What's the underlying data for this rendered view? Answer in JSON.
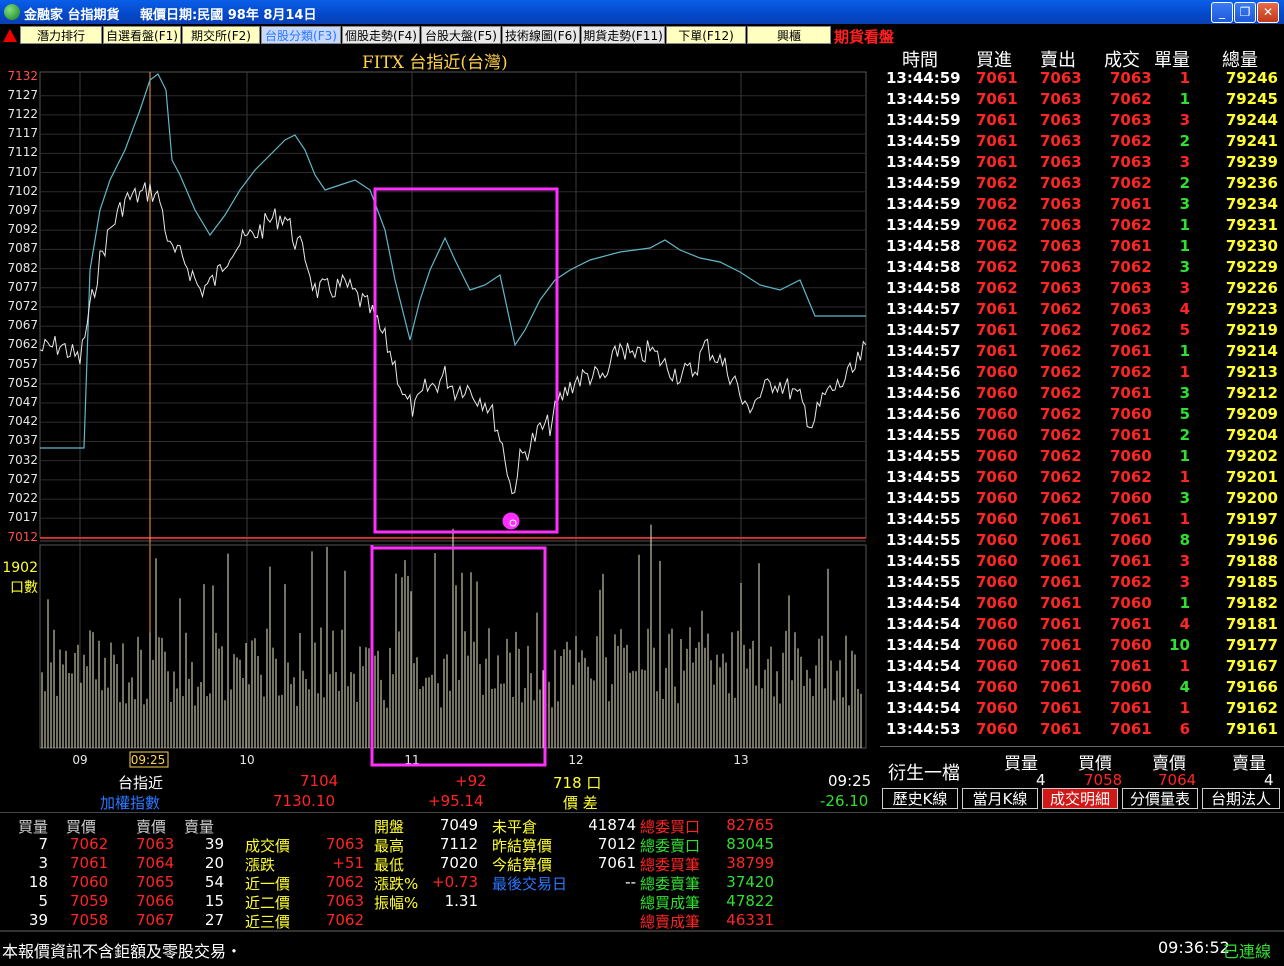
{
  "window": {
    "app": "金融家",
    "product": "台指期貨",
    "date_label": "報價日期:民國 98年 8月14日"
  },
  "tabs": [
    {
      "label": "潛力排行"
    },
    {
      "label": "自選看盤(F1)"
    },
    {
      "label": "期交所(F2)"
    },
    {
      "label": "台股分類(F3)"
    },
    {
      "label": "個股走勢(F4)"
    },
    {
      "label": "台股大盤(F5)"
    },
    {
      "label": "技術線圖(F6)"
    },
    {
      "label": "期貨走勢(F11)"
    },
    {
      "label": "下單(F12)"
    },
    {
      "label": "興櫃"
    }
  ],
  "futures_label": "期貨看盤",
  "chart": {
    "title": "FITX  台指近(台灣)",
    "price_labels": [
      "7132",
      "7127",
      "7122",
      "7117",
      "7112",
      "7107",
      "7102",
      "7097",
      "7092",
      "7087",
      "7082",
      "7077",
      "7072",
      "7067",
      "7062",
      "7057",
      "7052",
      "7047",
      "7042",
      "7037",
      "7032",
      "7027",
      "7022",
      "7017",
      "7012"
    ],
    "vol_max": "1902",
    "vol_label": "口數",
    "x_ticks": [
      "09",
      "09:25",
      "10",
      "11",
      "12",
      "13"
    ]
  },
  "info": {
    "r1_name": "台指近",
    "r1_price": "7104",
    "r1_change": "+92",
    "r1_vol": "718 口",
    "r1_time": "09:25",
    "r2_name": "加權指數",
    "r2_price": "7130.10",
    "r2_change": "+95.14",
    "r2_label": "價  差",
    "r2_spread": "-26.10"
  },
  "trades": {
    "headers": [
      "時間",
      "買進",
      "賣出",
      "成交",
      "單量",
      "總量"
    ],
    "rows": [
      [
        "13:44:59",
        "7061",
        "7063",
        "7063",
        "1",
        "79246"
      ],
      [
        "13:44:59",
        "7061",
        "7063",
        "7062",
        "1",
        "79245"
      ],
      [
        "13:44:59",
        "7061",
        "7063",
        "7063",
        "3",
        "79244"
      ],
      [
        "13:44:59",
        "7061",
        "7063",
        "7062",
        "2",
        "79241"
      ],
      [
        "13:44:59",
        "7061",
        "7063",
        "7063",
        "3",
        "79239"
      ],
      [
        "13:44:59",
        "7062",
        "7063",
        "7062",
        "2",
        "79236"
      ],
      [
        "13:44:59",
        "7062",
        "7063",
        "7061",
        "3",
        "79234"
      ],
      [
        "13:44:59",
        "7062",
        "7063",
        "7062",
        "1",
        "79231"
      ],
      [
        "13:44:58",
        "7062",
        "7063",
        "7061",
        "1",
        "79230"
      ],
      [
        "13:44:58",
        "7062",
        "7063",
        "7062",
        "3",
        "79229"
      ],
      [
        "13:44:58",
        "7062",
        "7063",
        "7063",
        "3",
        "79226"
      ],
      [
        "13:44:57",
        "7061",
        "7062",
        "7063",
        "4",
        "79223"
      ],
      [
        "13:44:57",
        "7061",
        "7062",
        "7062",
        "5",
        "79219"
      ],
      [
        "13:44:57",
        "7061",
        "7062",
        "7061",
        "1",
        "79214"
      ],
      [
        "13:44:56",
        "7060",
        "7062",
        "7062",
        "1",
        "79213"
      ],
      [
        "13:44:56",
        "7060",
        "7062",
        "7061",
        "3",
        "79212"
      ],
      [
        "13:44:56",
        "7060",
        "7062",
        "7060",
        "5",
        "79209"
      ],
      [
        "13:44:55",
        "7060",
        "7062",
        "7061",
        "2",
        "79204"
      ],
      [
        "13:44:55",
        "7060",
        "7062",
        "7060",
        "1",
        "79202"
      ],
      [
        "13:44:55",
        "7060",
        "7062",
        "7062",
        "1",
        "79201"
      ],
      [
        "13:44:55",
        "7060",
        "7062",
        "7060",
        "3",
        "79200"
      ],
      [
        "13:44:55",
        "7060",
        "7061",
        "7061",
        "1",
        "79197"
      ],
      [
        "13:44:55",
        "7060",
        "7061",
        "7060",
        "8",
        "79196"
      ],
      [
        "13:44:55",
        "7060",
        "7061",
        "7061",
        "3",
        "79188"
      ],
      [
        "13:44:55",
        "7060",
        "7061",
        "7062",
        "3",
        "79185"
      ],
      [
        "13:44:54",
        "7060",
        "7061",
        "7060",
        "1",
        "79182"
      ],
      [
        "13:44:54",
        "7060",
        "7061",
        "7061",
        "4",
        "79181"
      ],
      [
        "13:44:54",
        "7060",
        "7061",
        "7060",
        "10",
        "79177"
      ],
      [
        "13:44:54",
        "7060",
        "7061",
        "7061",
        "1",
        "79167"
      ],
      [
        "13:44:54",
        "7060",
        "7061",
        "7060",
        "4",
        "79166"
      ],
      [
        "13:44:54",
        "7060",
        "7061",
        "7061",
        "1",
        "79162"
      ],
      [
        "13:44:53",
        "7060",
        "7061",
        "7061",
        "6",
        "79161"
      ]
    ],
    "qty_colors": [
      "red",
      "grn",
      "red",
      "grn",
      "red",
      "grn",
      "grn",
      "grn",
      "grn",
      "grn",
      "red",
      "red",
      "red",
      "grn",
      "red",
      "grn",
      "grn",
      "grn",
      "grn",
      "red",
      "grn",
      "red",
      "grn",
      "red",
      "red",
      "grn",
      "red",
      "grn",
      "red",
      "grn",
      "red",
      "red"
    ]
  },
  "derivative": {
    "label": "衍生一檔",
    "h1": "買量",
    "h2": "買價",
    "h3": "賣價",
    "h4": "賣量",
    "v1": "4",
    "v2": "7058",
    "v3": "7064",
    "v4": "4"
  },
  "buttons": [
    "歷史K線",
    "當月K線",
    "成交明細",
    "分價量表",
    "台期法人"
  ],
  "quote": {
    "depth_headers": [
      "買量",
      "買價",
      "賣價",
      "賣量"
    ],
    "depth": [
      [
        "7",
        "7062",
        "7063",
        "39"
      ],
      [
        "3",
        "7061",
        "7064",
        "20"
      ],
      [
        "18",
        "7060",
        "7065",
        "54"
      ],
      [
        "5",
        "7059",
        "7066",
        "15"
      ],
      [
        "39",
        "7058",
        "7067",
        "27"
      ]
    ],
    "c2": [
      [
        "成交價",
        "7063"
      ],
      [
        "漲跌",
        "+51"
      ],
      [
        "近一價",
        "7062"
      ],
      [
        "近二價",
        "7063"
      ],
      [
        "近三價",
        "7062"
      ]
    ],
    "c3": [
      [
        "開盤",
        "7049"
      ],
      [
        "最高",
        "7112"
      ],
      [
        "最低",
        "7020"
      ],
      [
        "漲跌%",
        "+0.73"
      ],
      [
        "振幅%",
        "1.31"
      ]
    ],
    "c4": [
      [
        "未平倉",
        "41874"
      ],
      [
        "昨結算價",
        "7012"
      ],
      [
        "今結算價",
        "7061"
      ],
      [
        "最後交易日",
        "--"
      ]
    ],
    "c5": [
      [
        "總委買口",
        "82765"
      ],
      [
        "總委賣口",
        "83045"
      ],
      [
        "總委買筆",
        "38799"
      ],
      [
        "總委賣筆",
        "37420"
      ],
      [
        "總買成筆",
        "47822"
      ],
      [
        "總賣成筆",
        "46331"
      ]
    ]
  },
  "status": {
    "notice": "本報價資訊不含鉅額及零股交易・",
    "time": "09:36:52",
    "conn": "已連線"
  }
}
